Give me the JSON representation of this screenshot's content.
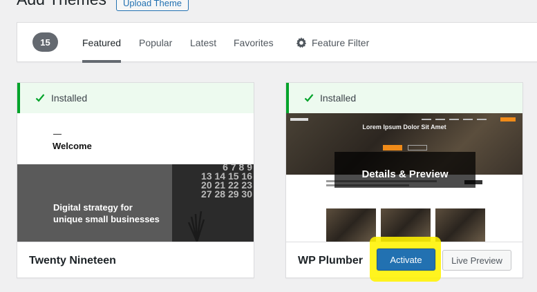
{
  "header": {
    "title": "Add Themes",
    "upload_label": "Upload Theme"
  },
  "filter_bar": {
    "count": "15",
    "tabs": [
      {
        "label": "Featured",
        "active": true
      },
      {
        "label": "Popular",
        "active": false
      },
      {
        "label": "Latest",
        "active": false
      },
      {
        "label": "Favorites",
        "active": false
      }
    ],
    "feature_filter_label": "Feature Filter"
  },
  "themes": [
    {
      "name": "Twenty Nineteen",
      "status": "Installed",
      "preview": {
        "welcome": "Welcome",
        "headline_line1": "Digital strategy for",
        "headline_line2": "unique small businesses",
        "calendar_rows": [
          "6 7 8 9",
          "13 14 15 16",
          "20 21 22 23",
          "27 28 29 30"
        ]
      }
    },
    {
      "name": "WP Plumber",
      "status": "Installed",
      "preview": {
        "hero_title": "Lorem Ipsum Dolor Sit Amet"
      },
      "details_label": "Details & Preview",
      "activate_label": "Activate",
      "live_preview_label": "Live Preview"
    }
  ],
  "colors": {
    "accent": "#2271b1",
    "installed_bg": "#edfaef",
    "installed_border": "#00a32a",
    "highlight": "#fff300"
  }
}
